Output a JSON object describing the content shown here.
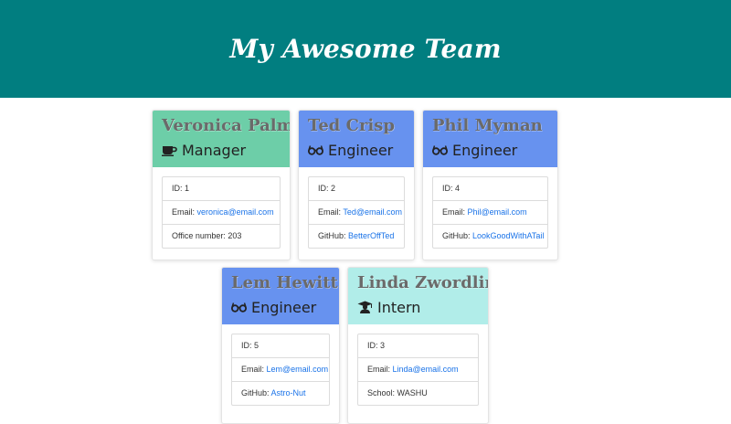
{
  "header": {
    "title": "My Awesome Team"
  },
  "colors": {
    "header_bg": "#017e80",
    "manager_bg": "#6dcea8",
    "engineer_bg": "#6792ef",
    "intern_bg": "#b1ede9"
  },
  "cards": [
    {
      "name": "Veronica Palmer",
      "role": "Manager",
      "icon": "coffee-icon",
      "id_label": "ID: ",
      "id": "1",
      "email_label": "Email: ",
      "email": "veronica@email.com",
      "extra_label": "Office number: ",
      "extra": "203"
    },
    {
      "name": "Ted Crisp",
      "role": "Engineer",
      "icon": "glasses-icon",
      "id_label": "ID: ",
      "id": "2",
      "email_label": "Email: ",
      "email": "Ted@email.com",
      "extra_label": "GitHub: ",
      "extra": "BetterOffTed"
    },
    {
      "name": "Phil Myman",
      "role": "Engineer",
      "icon": "glasses-icon",
      "id_label": "ID: ",
      "id": "4",
      "email_label": "Email: ",
      "email": "Phil@email.com",
      "extra_label": "GitHub: ",
      "extra": "LookGoodWithATail"
    },
    {
      "name": "Lem Hewitt",
      "role": "Engineer",
      "icon": "glasses-icon",
      "id_label": "ID: ",
      "id": "5",
      "email_label": "Email: ",
      "email": "Lem@email.com",
      "extra_label": "GitHub: ",
      "extra": "Astro-Nut"
    },
    {
      "name": "Linda Zwordling",
      "role": "Intern",
      "icon": "graduate-icon",
      "id_label": "ID: ",
      "id": "3",
      "email_label": "Email: ",
      "email": "Linda@email.com",
      "extra_label": "School: ",
      "extra": "WASHU"
    }
  ]
}
